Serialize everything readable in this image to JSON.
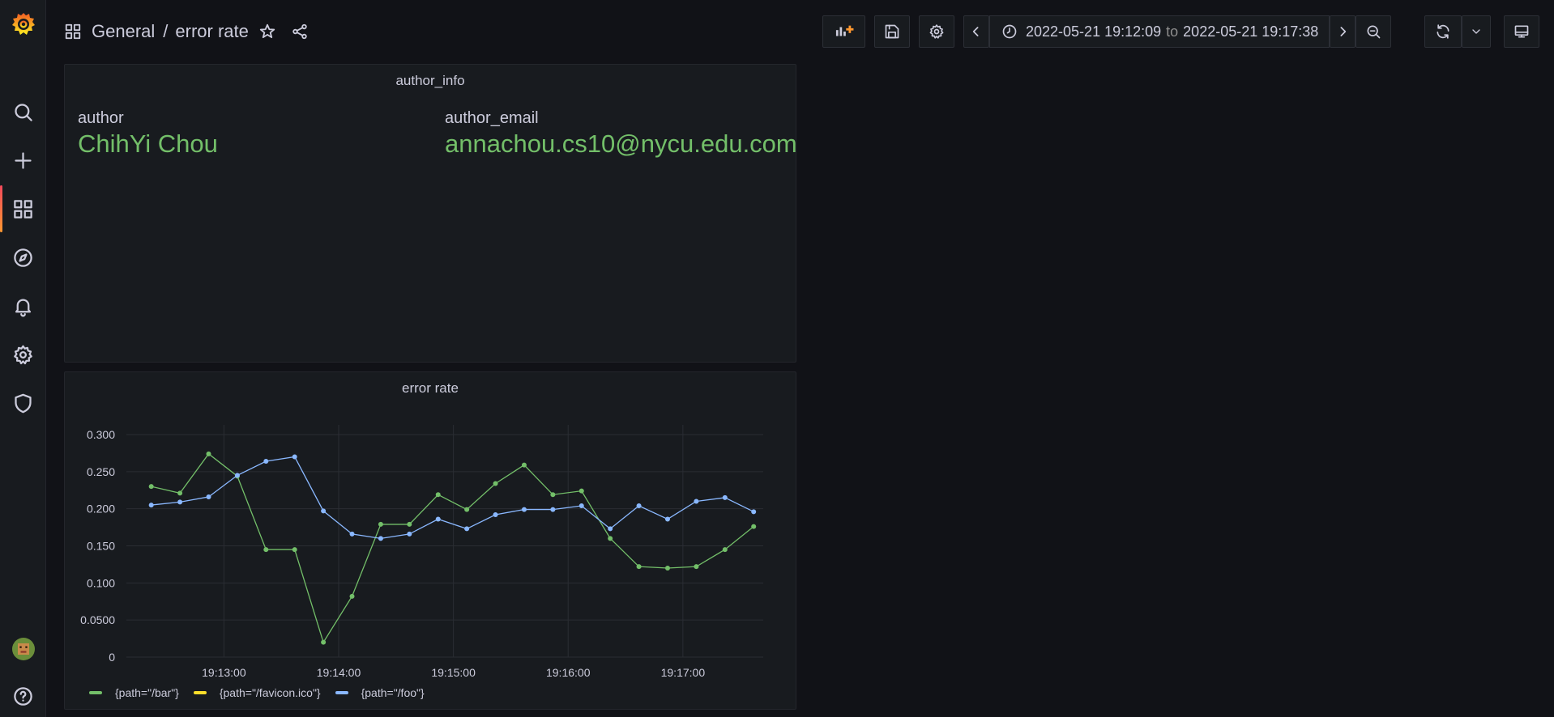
{
  "sidebar": {
    "items": [
      {
        "name": "grafana-logo-icon"
      },
      {
        "name": "search-icon"
      },
      {
        "name": "plus-icon"
      },
      {
        "name": "dashboards-icon"
      },
      {
        "name": "explore-compass-icon"
      },
      {
        "name": "bell-icon"
      },
      {
        "name": "gear-icon"
      },
      {
        "name": "shield-icon"
      },
      {
        "name": "user-avatar"
      },
      {
        "name": "help-icon"
      }
    ]
  },
  "breadcrumb": {
    "folder": "General",
    "separator": "/",
    "dashboard": "error rate"
  },
  "time_range": {
    "from": "2022-05-21 19:12:09",
    "to_label": "to",
    "to": "2022-05-21 19:17:38"
  },
  "panels": {
    "author_info": {
      "title": "author_info",
      "author_label": "author",
      "author_value": "ChihYi Chou",
      "email_label": "author_email",
      "email_value": "annachou.cs10@nycu.edu.com"
    },
    "error_rate": {
      "title": "error rate"
    }
  },
  "colors": {
    "accent_green": "#73bf69",
    "series_yellow": "#fade2a",
    "series_blue": "#8ab8ff"
  },
  "chart_data": {
    "type": "line",
    "title": "error rate",
    "x": [
      "19:12:22",
      "19:12:37",
      "19:12:52",
      "19:13:07",
      "19:13:22",
      "19:13:37",
      "19:13:52",
      "19:14:07",
      "19:14:22",
      "19:14:37",
      "19:14:52",
      "19:15:07",
      "19:15:22",
      "19:15:37",
      "19:15:52",
      "19:16:07",
      "19:16:22",
      "19:16:37",
      "19:16:52",
      "19:17:07",
      "19:17:22",
      "19:17:37"
    ],
    "x_ticks": [
      "19:13:00",
      "19:14:00",
      "19:15:00",
      "19:16:00",
      "19:17:00"
    ],
    "y_ticks": [
      "0",
      "0.0500",
      "0.100",
      "0.150",
      "0.200",
      "0.250",
      "0.300"
    ],
    "ylim": [
      0,
      0.3
    ],
    "grid": true,
    "legend": "bottom-left",
    "series": [
      {
        "name": "{path=\"/bar\"}",
        "color": "#73bf69",
        "values": [
          0.23,
          0.221,
          0.274,
          0.244,
          0.145,
          0.145,
          0.02,
          0.082,
          0.179,
          0.179,
          0.219,
          0.199,
          0.234,
          0.259,
          0.219,
          0.224,
          0.16,
          0.122,
          0.12,
          0.122,
          0.145,
          0.176
        ]
      },
      {
        "name": "{path=\"/favicon.ico\"}",
        "color": "#fade2a",
        "values": []
      },
      {
        "name": "{path=\"/foo\"}",
        "color": "#8ab8ff",
        "values": [
          0.205,
          0.209,
          0.216,
          0.245,
          0.264,
          0.27,
          0.197,
          0.166,
          0.16,
          0.166,
          0.186,
          0.173,
          0.192,
          0.199,
          0.199,
          0.204,
          0.173,
          0.204,
          0.186,
          0.21,
          0.215,
          0.196
        ]
      }
    ]
  }
}
